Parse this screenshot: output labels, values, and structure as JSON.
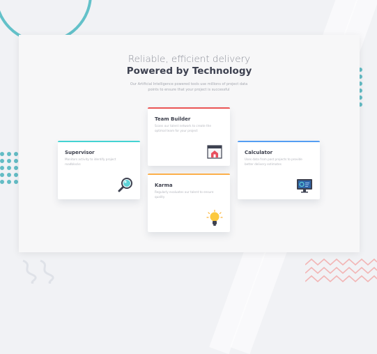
{
  "hero": {
    "title_light": "Reliable, efficient delivery",
    "title_bold": "Powered by Technology",
    "intro": "Our Artificial Intelligence powered tools use millions of project data points to ensure that your project is successful"
  },
  "cards": {
    "supervisor": {
      "title": "Supervisor",
      "desc": "Monitors activity to identify project roadblocks",
      "accent": "#44d3d2",
      "icon": "magnifier-icon"
    },
    "team_builder": {
      "title": "Team Builder",
      "desc": "Scans our talent network to create the optimal team for your project",
      "accent": "#ea5454",
      "icon": "house-chart-icon"
    },
    "karma": {
      "title": "Karma",
      "desc": "Regularly evaluates our talent to ensure quality",
      "accent": "#fcaf4a",
      "icon": "lightbulb-icon"
    },
    "calculator": {
      "title": "Calculator",
      "desc": "Uses data from past projects to provide better delivery estimates",
      "accent": "#549ef2",
      "icon": "monitor-icon"
    }
  }
}
